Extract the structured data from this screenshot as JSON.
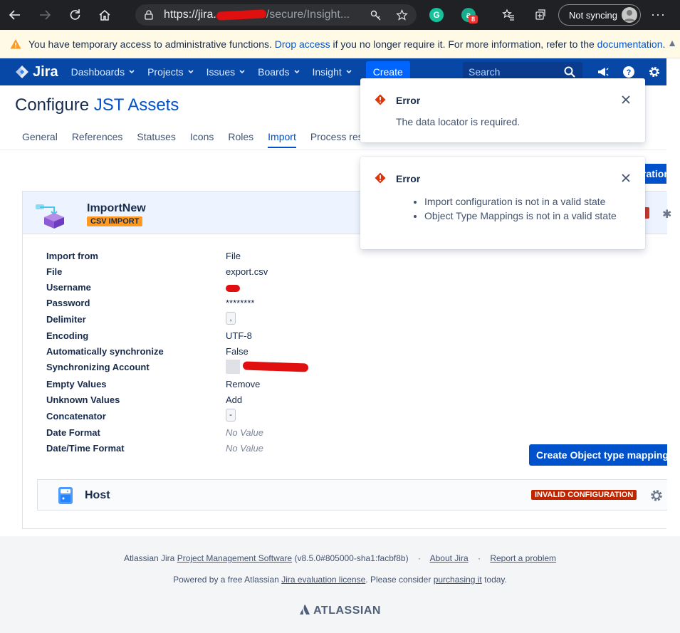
{
  "browser": {
    "url_prefix": "https://jira.",
    "url_suffix": "/secure/Insight...",
    "extension_badge": "8",
    "sync_label": "Not syncing"
  },
  "banner": {
    "text_before": "You have temporary access to administrative functions.",
    "drop_link": "Drop access",
    "text_middle": "if you no longer require it. For more information, refer to the",
    "doc_link": "documentation",
    "text_end": "."
  },
  "header": {
    "logo": "Jira",
    "nav": [
      "Dashboards",
      "Projects",
      "Issues",
      "Boards",
      "Insight"
    ],
    "create": "Create",
    "search_placeholder": "Search"
  },
  "page": {
    "title_prefix": "Configure ",
    "title_link": "JST Assets",
    "tabs": [
      "General",
      "References",
      "Statuses",
      "Icons",
      "Roles",
      "Import",
      "Process resu"
    ],
    "active_tab": "Import",
    "cut_button": "ration"
  },
  "import": {
    "name": "ImportNew",
    "type_badge": "CSV IMPORT",
    "rows": [
      {
        "label": "Import from",
        "value": "File"
      },
      {
        "label": "File",
        "value": "export.csv"
      },
      {
        "label": "Username",
        "value": ""
      },
      {
        "label": "Password",
        "value": "********"
      },
      {
        "label": "Delimiter",
        "value": ","
      },
      {
        "label": "Encoding",
        "value": "UTF-8"
      },
      {
        "label": "Automatically synchronize",
        "value": "False"
      },
      {
        "label": "Synchronizing Account",
        "value": ""
      },
      {
        "label": "Empty Values",
        "value": "Remove"
      },
      {
        "label": "Unknown Values",
        "value": "Add"
      },
      {
        "label": "Concatenator",
        "value": "-"
      },
      {
        "label": "Date Format",
        "value": "No Value"
      },
      {
        "label": "Date/Time Format",
        "value": "No Value"
      }
    ],
    "create_mapping_button": "Create Object type mapping",
    "host_label": "Host",
    "host_status": "INVALID CONFIGURATION"
  },
  "footer": {
    "prefix": "Atlassian Jira",
    "pm_link": "Project Management Software",
    "version": "(v8.5.0#805000-sha1:facbf8b)",
    "about": "About Jira",
    "report": "Report a problem",
    "powered_prefix": "Powered by a free Atlassian",
    "license_link": "Jira evaluation license",
    "powered_mid": ". Please consider",
    "purchase_link": "purchasing it",
    "powered_end": "today.",
    "brand": "ATLASSIAN"
  },
  "flags": [
    {
      "title": "Error",
      "body": "The data locator is required."
    },
    {
      "title": "Error",
      "items": [
        "Import configuration is not in a valid state",
        "Object Type Mappings is not in a valid state"
      ]
    }
  ],
  "colors": {
    "jira_header": "#0747a6",
    "primary_button": "#0052cc",
    "error_red": "#de350b",
    "csv_badge": "#ff991f",
    "invalid_badge": "#bf2600"
  }
}
